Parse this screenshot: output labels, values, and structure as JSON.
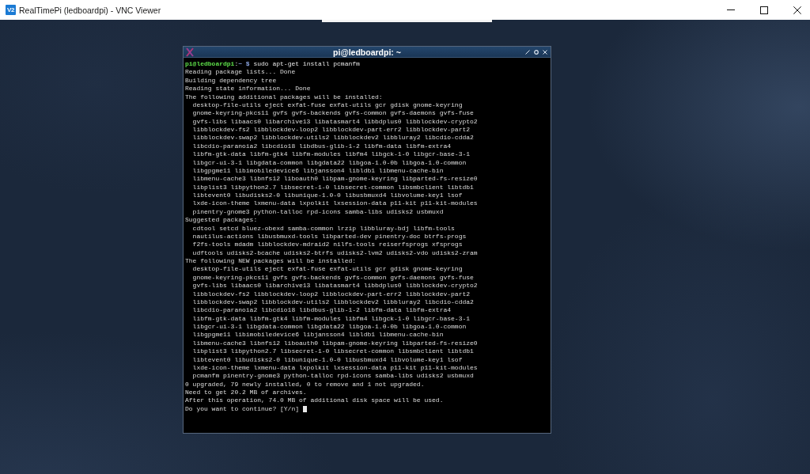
{
  "window": {
    "logo_text": "V2",
    "title": "RealTimePi (ledboardpi) - VNC Viewer"
  },
  "terminal": {
    "title": "pi@ledboardpi: ~",
    "prompt": {
      "user_host": "pi@ledboardpi",
      "separator": ":",
      "path": "~",
      "symbol": "$",
      "command": "sudo apt-get install pcmanfm"
    },
    "output": [
      {
        "text": "Reading package lists... Done"
      },
      {
        "text": "Building dependency tree"
      },
      {
        "text": "Reading state information... Done"
      },
      {
        "text": "The following additional packages will be installed:",
        "children": [
          {
            "text": "desktop-file-utils eject exfat-fuse exfat-utils gcr gdisk gnome-keyring"
          },
          {
            "text": "gnome-keyring-pkcs11 gvfs gvfs-backends gvfs-common gvfs-daemons gvfs-fuse"
          },
          {
            "text": "gvfs-libs libaacs0 libarchive13 libatasmart4 libbdplus0 libblockdev-crypto2"
          },
          {
            "text": "libblockdev-fs2 libblockdev-loop2 libblockdev-part-err2 libblockdev-part2"
          },
          {
            "text": "libblockdev-swap2 libblockdev-utils2 libblockdev2 libbluray2 libcdio-cdda2"
          },
          {
            "text": "libcdio-paranoia2 libcdio18 libdbus-glib-1-2 libfm-data libfm-extra4"
          },
          {
            "text": "libfm-gtk-data libfm-gtk4 libfm-modules libfm4 libgck-1-0 libgcr-base-3-1"
          },
          {
            "text": "libgcr-ui-3-1 libgdata-common libgdata22 libgoa-1.0-0b libgoa-1.0-common"
          },
          {
            "text": "libgpgme11 libimobiledevice6 libjansson4 libldb1 libmenu-cache-bin"
          },
          {
            "text": "libmenu-cache3 libnfs12 liboauth0 libpam-gnome-keyring libparted-fs-resize0"
          },
          {
            "text": "libplist3 libpython2.7 libsecret-1-0 libsecret-common libsmbclient libtdb1"
          },
          {
            "text": "libtevent0 libudisks2-0 libunique-1.0-0 libusbmuxd4 libvolume-key1 lsof"
          },
          {
            "text": "lxde-icon-theme lxmenu-data lxpolkit lxsession-data p11-kit p11-kit-modules"
          },
          {
            "text": "pinentry-gnome3 python-talloc rpd-icons samba-libs udisks2 usbmuxd"
          }
        ]
      },
      {
        "text": "Suggested packages:",
        "children": [
          {
            "text": "cdtool setcd bluez-obexd samba-common lrzip libbluray-bdj libfm-tools"
          },
          {
            "text": "nautilus-actions libusbmuxd-tools libparted-dev pinentry-doc btrfs-progs"
          },
          {
            "text": "f2fs-tools mdadm libblockdev-mdraid2 nilfs-tools reiserfsprogs xfsprogs"
          },
          {
            "text": "udftools udisks2-bcache udisks2-btrfs udisks2-lvm2 udisks2-vdo udisks2-zram"
          }
        ]
      },
      {
        "text": "The following NEW packages will be installed:",
        "children": [
          {
            "text": "desktop-file-utils eject exfat-fuse exfat-utils gcr gdisk gnome-keyring"
          },
          {
            "text": "gnome-keyring-pkcs11 gvfs gvfs-backends gvfs-common gvfs-daemons gvfs-fuse"
          },
          {
            "text": "gvfs-libs libaacs0 libarchive13 libatasmart4 libbdplus0 libblockdev-crypto2"
          },
          {
            "text": "libblockdev-fs2 libblockdev-loop2 libblockdev-part-err2 libblockdev-part2"
          },
          {
            "text": "libblockdev-swap2 libblockdev-utils2 libblockdev2 libbluray2 libcdio-cdda2"
          },
          {
            "text": "libcdio-paranoia2 libcdio18 libdbus-glib-1-2 libfm-data libfm-extra4"
          },
          {
            "text": "libfm-gtk-data libfm-gtk4 libfm-modules libfm4 libgck-1-0 libgcr-base-3-1"
          },
          {
            "text": "libgcr-ui-3-1 libgdata-common libgdata22 libgoa-1.0-0b libgoa-1.0-common"
          },
          {
            "text": "libgpgme11 libimobiledevice6 libjansson4 libldb1 libmenu-cache-bin"
          },
          {
            "text": "libmenu-cache3 libnfs12 liboauth0 libpam-gnome-keyring libparted-fs-resize0"
          },
          {
            "text": "libplist3 libpython2.7 libsecret-1-0 libsecret-common libsmbclient libtdb1"
          },
          {
            "text": "libtevent0 libudisks2-0 libunique-1.0-0 libusbmuxd4 libvolume-key1 lsof"
          },
          {
            "text": "lxde-icon-theme lxmenu-data lxpolkit lxsession-data p11-kit p11-kit-modules"
          },
          {
            "text": "pcmanfm pinentry-gnome3 python-talloc rpd-icons samba-libs udisks2 usbmuxd"
          }
        ]
      },
      {
        "text": "0 upgraded, 79 newly installed, 0 to remove and 1 not upgraded."
      },
      {
        "text": "Need to get 20.2 MB of archives."
      },
      {
        "text": "After this operation, 74.0 MB of additional disk space will be used."
      }
    ],
    "input_line": {
      "text": "Do you want to continue? [Y/n]",
      "cursor": true
    }
  }
}
